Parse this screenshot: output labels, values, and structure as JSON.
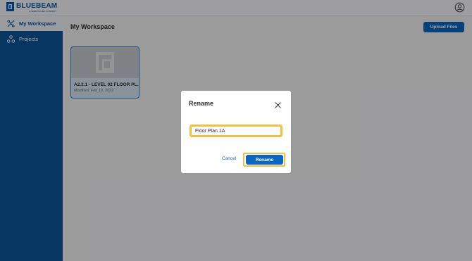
{
  "app": {
    "logo_name": "BLUEBEAM",
    "logo_sub": "A NEMETSCHEK COMPANY"
  },
  "sidebar": {
    "items": [
      {
        "label": "My Workspace",
        "icon": "workspace-icon",
        "active": true
      },
      {
        "label": "Projects",
        "icon": "projects-icon",
        "active": false
      }
    ]
  },
  "main": {
    "title": "My Workspace",
    "upload_label": "Upload Files",
    "files": [
      {
        "name": "A2.2.1 - LEVEL 02 FLOOR PL...",
        "modified": "Modified: Feb 10, 2022"
      }
    ]
  },
  "dialog": {
    "title": "Rename",
    "input_value": "Floor Plan 1A",
    "cancel_label": "Cancel",
    "confirm_label": "Rename"
  },
  "colors": {
    "brand": "#0b5599",
    "accent": "#0b66c3",
    "highlight": "#f5c13c"
  }
}
